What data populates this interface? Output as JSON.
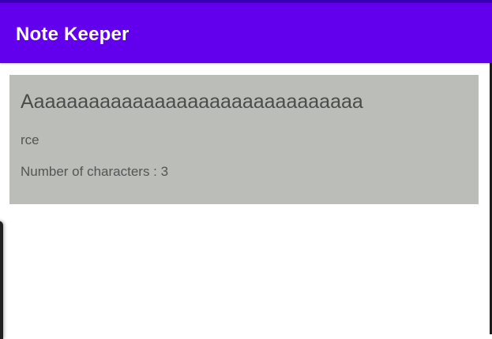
{
  "app_bar": {
    "title": "Note Keeper",
    "color": "#6200ee",
    "status_color": "#3a00b4"
  },
  "note": {
    "title": "Aaaaaaaaaaaaaaaaaaaaaaaaaaaaaaa",
    "body": "rce",
    "count_text": "Number of characters : 3",
    "card_color": "#bbbdb8"
  }
}
